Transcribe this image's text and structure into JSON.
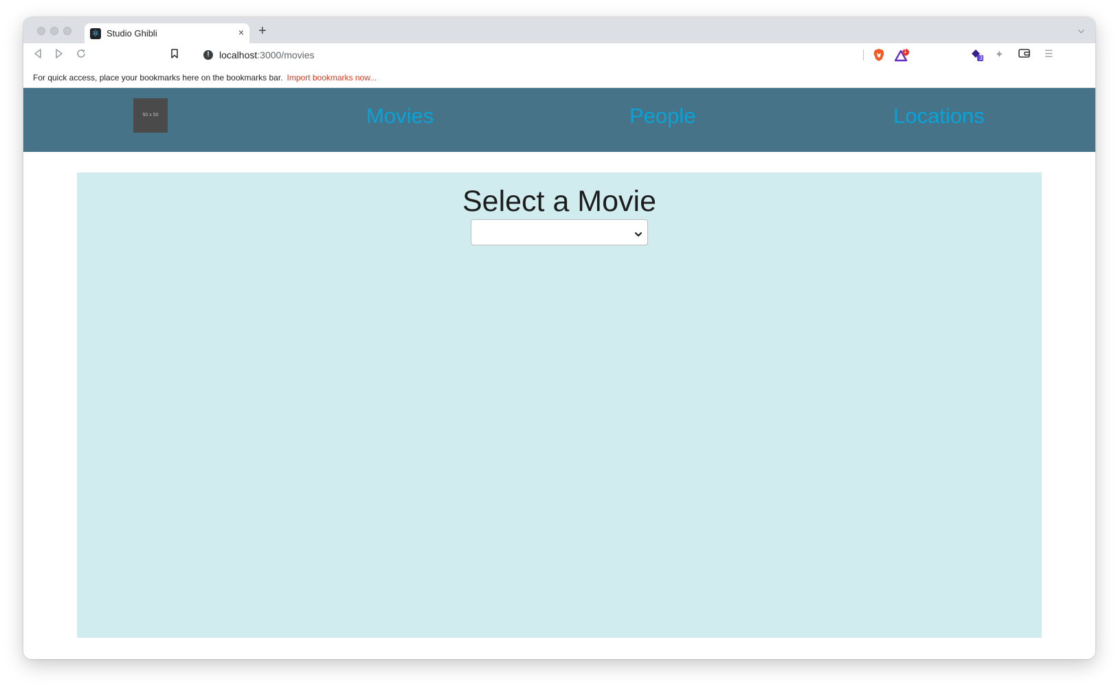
{
  "browser": {
    "tab_title": "Studio Ghibli",
    "tab_close": "×",
    "new_tab": "+",
    "url_host": "localhost",
    "url_path": ":3000/movies",
    "rewards_count": "1",
    "extension_badge": "3"
  },
  "bookmarks_bar": {
    "message": "For quick access, place your bookmarks here on the bookmarks bar.",
    "import_link": "Import bookmarks now..."
  },
  "navbar": {
    "logo_text": "50 x 50",
    "links": [
      "Movies",
      "People",
      "Locations"
    ],
    "link_color": "#0aa3d8",
    "background_color": "#477389"
  },
  "main": {
    "title": "Select a Movie",
    "select_value": "",
    "background_color": "#d0ecee"
  }
}
